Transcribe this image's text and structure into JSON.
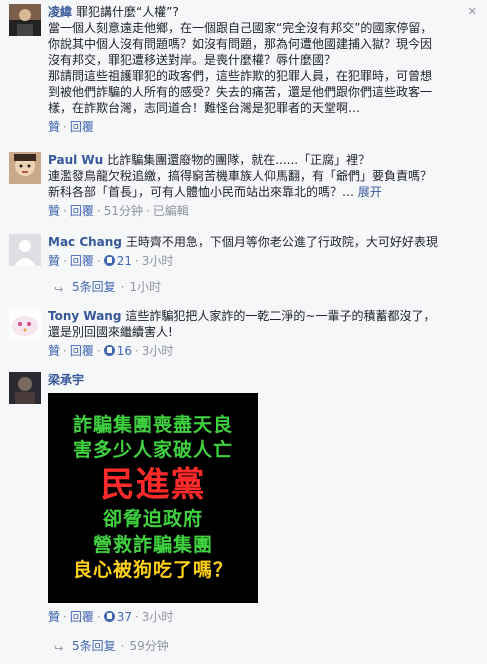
{
  "comments": [
    {
      "author": "凌緯",
      "text_lines": [
        "罪犯講什麼“人權”?",
        "當一個人刻意遠走他鄉，在一個跟自己國家“完全沒有邦交”的國家停留，",
        "你說其中個人沒有問題嗎？如沒有問題，那為何遭他國建捕入獄？現今因",
        "沒有邦交，罪犯遭移送對岸。是喪什麼權？辱什麼國？",
        "那請問這些祖護罪犯的政客們，這些詐欺的犯罪人員，在犯罪時，可曾想",
        "到被他們詐騙的人所有的感受？失去的痛苦，還是他們跟你們這些政客一",
        "樣，在詐欺台灣，志同道合！難怪台灣是犯罪者的天堂啊…"
      ],
      "actions": [
        "贊",
        "回覆"
      ]
    },
    {
      "author": "Paul Wu",
      "text_lines": [
        "比詐騙集團還廢物的團隊，就在......「正腐」裡？",
        "連濫發鳥龍欠稅追繳，搞得窮苦機車族人仰馬翻，有「爺們」要負責嗎？",
        "新科各部「首長」，可有人體恤小民而站出來靠北的嗎？…"
      ],
      "more_label": "展开",
      "actions": [
        "贊",
        "回覆",
        "已編輯"
      ],
      "timestamp": "51分钟"
    },
    {
      "author": "Mac Chang",
      "text_lines": [
        "王時齊不用急，下個月等你老公進了行政院，大可好好表現"
      ],
      "actions": [
        "贊",
        "回覆"
      ],
      "likes": "21",
      "timestamp": "3小时",
      "replies": {
        "label": "5条回复",
        "time": "1小时"
      }
    },
    {
      "author": "Tony Wang",
      "text_lines": [
        "這些詐騙犯把人家詐的一乾二淨的~一輩子的積蓄都沒了，",
        "還是別回國來繼續害人!"
      ],
      "actions": [
        "贊",
        "回覆"
      ],
      "likes": "16",
      "timestamp": "3小时"
    },
    {
      "author": "梁承宇",
      "image_text": [
        "詐騙集團喪盡天良",
        "害多少人家破人亡",
        "民進黨",
        "卻脅迫政府",
        "營救詐騙集團",
        "良心被狗吃了嗎？"
      ],
      "actions": [
        "贊",
        "回覆"
      ],
      "likes": "37",
      "timestamp": "3小时",
      "replies": {
        "label": "5条回复",
        "time": "59分钟"
      }
    }
  ],
  "colors": {
    "link": "#365899",
    "action": "#4267b2",
    "meta": "#90949c",
    "background": "#f6f7f9"
  },
  "icons": {
    "close": "close-icon",
    "like": "thumbs-up-icon",
    "reply": "reply-arrow-icon"
  }
}
